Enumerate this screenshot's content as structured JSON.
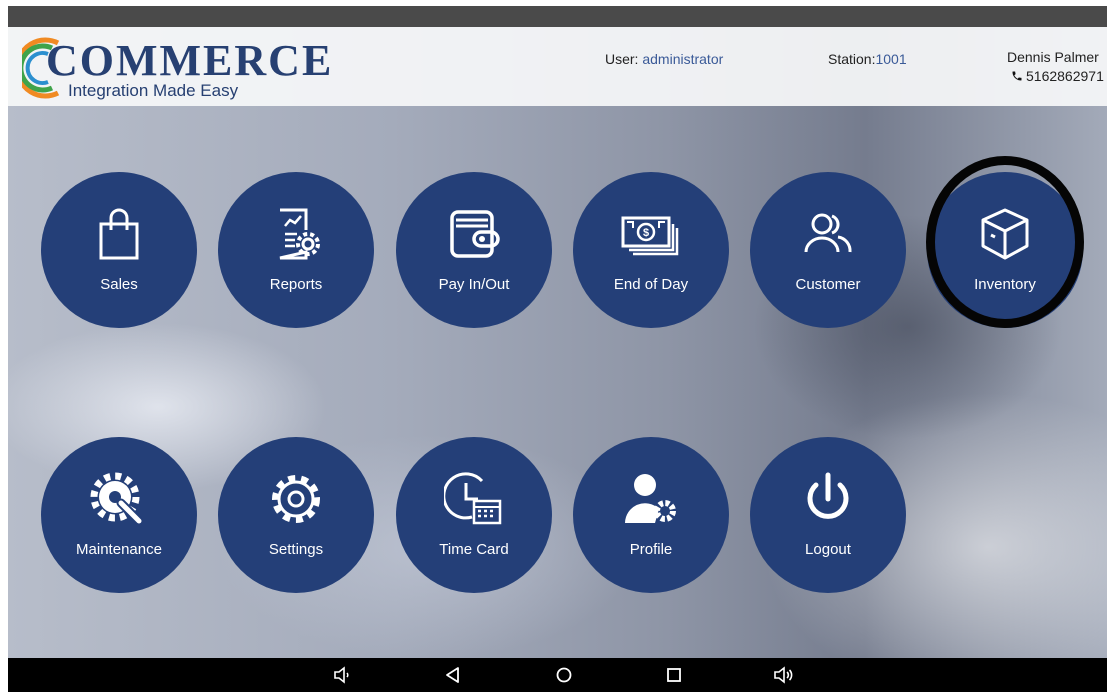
{
  "header": {
    "logo_word": "COMMERCE",
    "logo_tagline": "Integration Made Easy",
    "user_label": "User:",
    "user_value": "administrator",
    "station_label": "Station:",
    "station_value": "1001",
    "contact_name": "Dennis Palmer",
    "contact_phone": "5162862971"
  },
  "tiles_row1": [
    {
      "label": "Sales",
      "icon": "shopping-bag-icon"
    },
    {
      "label": "Reports",
      "icon": "report-gear-icon"
    },
    {
      "label": "Pay In/Out",
      "icon": "wallet-icon"
    },
    {
      "label": "End of Day",
      "icon": "cash-stack-icon"
    },
    {
      "label": "Customer",
      "icon": "users-icon"
    },
    {
      "label": "Inventory",
      "icon": "box-icon"
    }
  ],
  "tiles_row2": [
    {
      "label": "Maintenance",
      "icon": "wrench-gear-icon"
    },
    {
      "label": "Settings",
      "icon": "gear-icon"
    },
    {
      "label": "Time Card",
      "icon": "clock-calendar-icon"
    },
    {
      "label": "Profile",
      "icon": "user-gear-icon"
    },
    {
      "label": "Logout",
      "icon": "power-icon"
    }
  ],
  "highlighted_tile": "Inventory",
  "colors": {
    "tile": "#243f78",
    "header_bg": "#f6f7f9",
    "brand_blue": "#274072",
    "highlight_ring": "#050505"
  },
  "navbar": {
    "buttons": [
      "volume-down-icon",
      "back-icon",
      "home-icon",
      "recents-icon",
      "volume-up-icon"
    ]
  }
}
